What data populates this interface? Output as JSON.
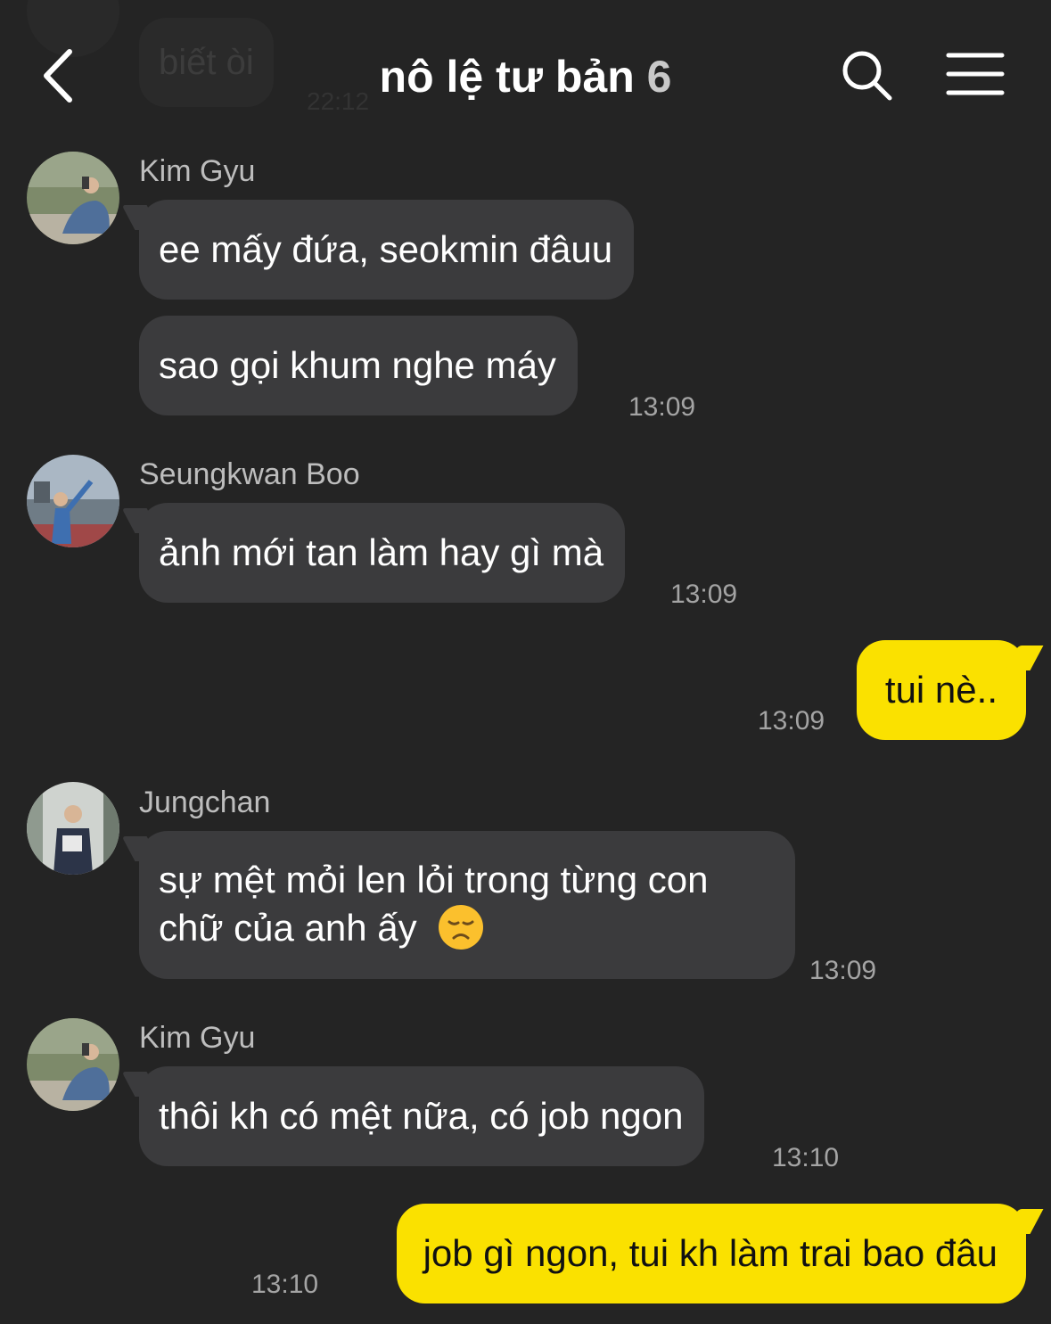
{
  "header": {
    "title": "nô lệ tư bản",
    "member_count": "6",
    "back_icon": "chevron-left-icon",
    "search_icon": "search-icon",
    "menu_icon": "hamburger-menu-icon"
  },
  "previous_message": {
    "text": "biết òi",
    "time": "22:12"
  },
  "colors": {
    "background": "#242424",
    "incoming_bubble": "#3b3b3d",
    "outgoing_bubble": "#fae100"
  },
  "messages": [
    {
      "sender": "Kim Gyu",
      "lines": [
        "ee mấy đứa, seokmin đâuu",
        "sao gọi khum nghe máy"
      ],
      "time": "13:09"
    },
    {
      "sender": "Seungkwan Boo",
      "lines": [
        "ảnh mới tan làm hay gì mà"
      ],
      "time": "13:09"
    },
    {
      "sender": "me",
      "lines": [
        "tui nè.."
      ],
      "time": "13:09"
    },
    {
      "sender": "Jungchan",
      "lines": [
        "sự mệt mỏi len lỏi trong từng con chữ của anh ấy"
      ],
      "emoji": "disappointed-face-emoji",
      "time": "13:09"
    },
    {
      "sender": "Kim Gyu",
      "lines": [
        "thôi kh có mệt nữa, có job ngon"
      ],
      "time": "13:10"
    },
    {
      "sender": "me",
      "lines": [
        "job gì ngon, tui kh làm trai bao đâu"
      ],
      "time": "13:10"
    }
  ]
}
